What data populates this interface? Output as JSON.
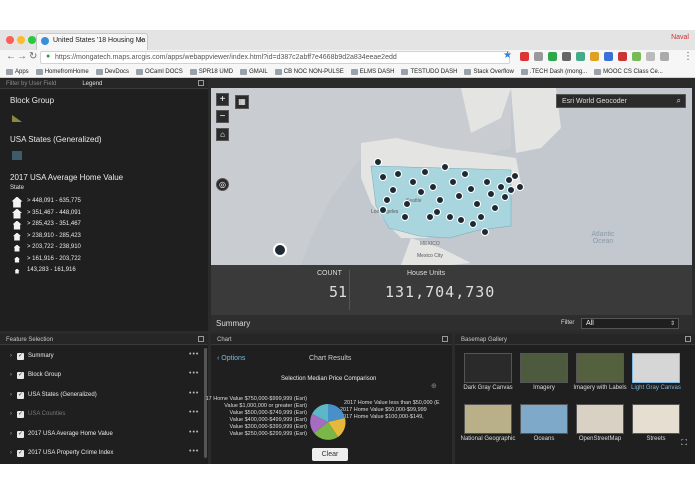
{
  "browser": {
    "tab_title": "United States '18 Housing Ma",
    "profile": "Naval",
    "url": "https://mongatech.maps.arcgis.com/apps/webappviewer/index.html?id=d387c2abff7e4668b9d2a834eeae2edd",
    "bookmarks": [
      "Apps",
      "HomefromHome",
      "DevDocs",
      "OCaml DOCS",
      "SPR18 UMD",
      "GMAIL",
      "CB NOC NON-PULSE",
      "ELMS DASH",
      "TESTUDO DASH",
      "Stack Overflow",
      ".TECH Dash (mong...",
      "MOOC CS Class Ce..."
    ]
  },
  "left_panel": {
    "filter_label": "Filter by User Field",
    "legend_tab": "Legend",
    "groups": [
      {
        "title": "Block Group"
      },
      {
        "title": "USA States (Generalized)"
      }
    ],
    "avg_home": {
      "title": "2017 USA Average Home Value",
      "sub": "State",
      "ranges": [
        "> 448,091 - 635,775",
        "> 351,467 - 448,091",
        "> 285,423 - 351,467",
        "> 238,910 - 285,423",
        "> 203,722 - 238,910",
        "> 161,916 - 203,722",
        "143,283 - 161,916"
      ]
    }
  },
  "map": {
    "geocoder_placeholder": "Esri World Geocoder",
    "labels": [
      "Seattle",
      "Los Angeles",
      "Mexico City",
      "Atlantic Ocean",
      "MEXICO"
    ],
    "count_label": "COUNT",
    "count_value": "51",
    "units_label": "House Units",
    "units_value": "131,704,730",
    "summary": "Summary",
    "filter_label": "Filter",
    "filter_value": "All"
  },
  "feature_selection": {
    "title": "Feature Selection",
    "items": [
      {
        "label": "Summary",
        "dim": false
      },
      {
        "label": "Block Group",
        "dim": false
      },
      {
        "label": "USA States (Generalized)",
        "dim": false
      },
      {
        "label": "USA Counties",
        "dim": true
      },
      {
        "label": "2017 USA Average Home Value",
        "dim": false
      },
      {
        "label": "2017 USA Property Crime Index",
        "dim": false
      }
    ]
  },
  "chart_panel": {
    "title": "Chart",
    "options": "Options",
    "results": "Chart Results",
    "chart_title": "Selection Median Price Comparison",
    "clear": "Clear",
    "legend_left": [
      "17 Home Value $750,000-$999,999 (Esri)",
      "Value $1,000,000 or greater (Esri)",
      "Value $500,000-$749,999 (Esri)",
      "Value $400,000-$499,999 (Esri)",
      "Value $300,000-$399,999 (Esri)",
      "Value $250,000-$299,999 (Esri)"
    ],
    "legend_right": [
      "2017 Home Value less than $50,000 (E",
      "2017 Home Value $50,000-$99,999",
      "2017 Home Value $100,000-$149,"
    ]
  },
  "basemap": {
    "title": "Basemap Gallery",
    "items": [
      {
        "label": "Dark Gray Canvas",
        "color": "#2a2a2a",
        "selected": false
      },
      {
        "label": "Imagery",
        "color": "#4d5a3d",
        "selected": false
      },
      {
        "label": "Imagery with Labels",
        "color": "#55603f",
        "selected": false
      },
      {
        "label": "Light Gray Canvas",
        "color": "#d6d6d6",
        "selected": true
      },
      {
        "label": "National Geographic",
        "color": "#b9b08a",
        "selected": false
      },
      {
        "label": "Oceans",
        "color": "#7fa9c9",
        "selected": false
      },
      {
        "label": "OpenStreetMap",
        "color": "#d9d1c4",
        "selected": false
      },
      {
        "label": "Streets",
        "color": "#e6ded0",
        "selected": false
      }
    ]
  }
}
